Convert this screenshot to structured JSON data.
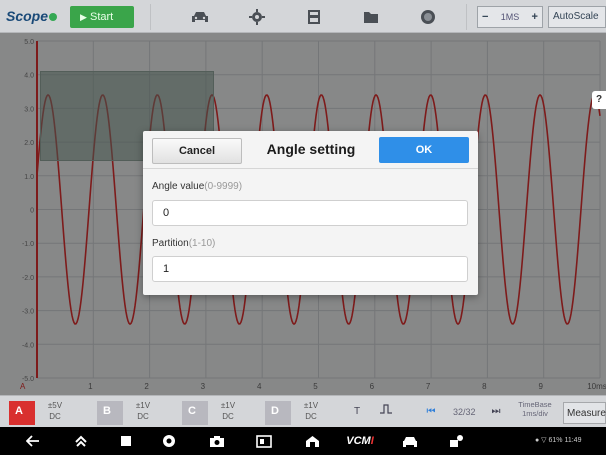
{
  "toolbar": {
    "brand": "Scope",
    "start_label": "Start",
    "timebase_value": "1MS",
    "timebase_minus": "−",
    "timebase_plus": "+",
    "autoscale_label": "AutoScale"
  },
  "scope": {
    "y_axis_labels": [
      "5.0",
      "4.0",
      "3.0",
      "2.0",
      "1.0",
      "0",
      "-1.0",
      "-2.0",
      "-3.0",
      "-4.0",
      "-5.0"
    ],
    "x_axis_labels": [
      "1",
      "2",
      "3",
      "4",
      "5",
      "6",
      "7",
      "8",
      "9",
      "10ms"
    ],
    "channel_marker": "A"
  },
  "dialog": {
    "cancel_label": "Cancel",
    "title": "Angle setting",
    "ok_label": "OK",
    "angle_label": "Angle value",
    "angle_range": "(0-9999)",
    "angle_value": "0",
    "partition_label": "Partition",
    "partition_range": "(1-10)",
    "partition_value": "1"
  },
  "channel_bar": {
    "channels": [
      {
        "name": "A",
        "sub": "+",
        "color": "#d9302f",
        "range": "±5V",
        "coupling": "DC"
      },
      {
        "name": "B",
        "sub": "+",
        "color": "#b8b8bf",
        "range": "±1V",
        "coupling": "DC"
      },
      {
        "name": "C",
        "sub": "+",
        "color": "#b8b8bf",
        "range": "±1V",
        "coupling": "DC"
      },
      {
        "name": "D",
        "sub": "+",
        "color": "#b8b8bf",
        "range": "±1V",
        "coupling": "DC"
      }
    ],
    "trigger_label": "T",
    "page_count": "32/32",
    "timebase_div_line1": "TimeBase",
    "timebase_div_line2": "1ms/div",
    "measure_label": "Measure"
  },
  "navbar": {
    "vcm_label_a": "VCM",
    "vcm_label_b": "I",
    "status_text": "61% 11:49"
  }
}
